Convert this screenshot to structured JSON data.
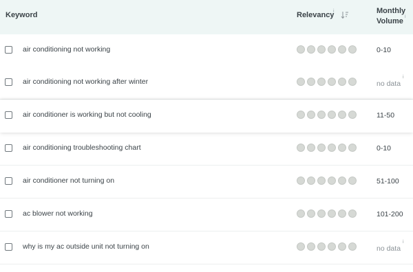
{
  "header": {
    "keyword": "Keyword",
    "relevancy": "Relevancy",
    "relevancy_info": "i",
    "volume_line1": "Monthly",
    "volume_line2": "Volume",
    "volume_info": "i"
  },
  "rows": [
    {
      "keyword": "air conditioning not working",
      "volume": "0-10",
      "relevancy_dots": 6,
      "relevancy_filled": 0
    },
    {
      "keyword": "air conditioning not working after winter",
      "volume": "no data",
      "volume_info": "i",
      "relevancy_dots": 6,
      "relevancy_filled": 0
    },
    {
      "keyword": "air conditioner is working but not cooling",
      "volume": "11-50",
      "relevancy_dots": 6,
      "relevancy_filled": 0
    },
    {
      "keyword": "air conditioning troubleshooting chart",
      "volume": "0-10",
      "relevancy_dots": 6,
      "relevancy_filled": 0
    },
    {
      "keyword": "air conditioner not turning on",
      "volume": "51-100",
      "relevancy_dots": 6,
      "relevancy_filled": 0
    },
    {
      "keyword": "ac blower not working",
      "volume": "101-200",
      "relevancy_dots": 6,
      "relevancy_filled": 0
    },
    {
      "keyword": "why is my ac outside unit not turning on",
      "volume": "no data",
      "volume_info": "i",
      "relevancy_dots": 6,
      "relevancy_filled": 0
    }
  ],
  "colors": {
    "header_bg": "#eef6f5",
    "dot_empty": "#d6d9d5",
    "text": "#3a4247",
    "muted": "#8a9196"
  }
}
